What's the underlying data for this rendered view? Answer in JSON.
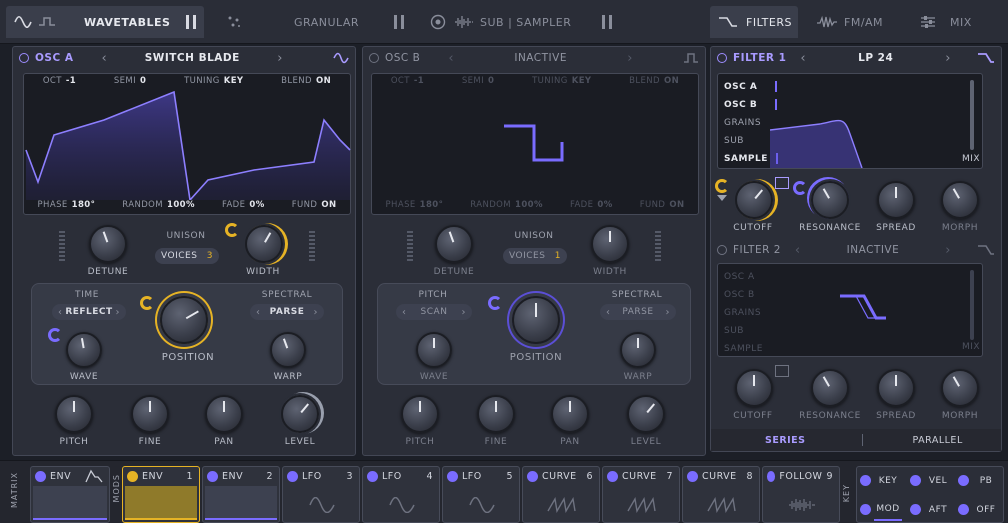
{
  "topbar": {
    "tabs": [
      {
        "label": "WAVETABLES",
        "active": true
      },
      {
        "label": "GRANULAR",
        "active": false
      },
      {
        "label": "SUB | SAMPLER",
        "active": false
      },
      {
        "label": "FILTERS",
        "active": true
      },
      {
        "label": "FM/AM",
        "active": false
      },
      {
        "label": "MIX",
        "active": false
      }
    ]
  },
  "osc_a": {
    "title": "OSC A",
    "preset": "SWITCH BLADE",
    "params_top": {
      "oct_label": "OCT",
      "oct": "-1",
      "semi_label": "SEMI",
      "semi": "0",
      "tuning_label": "TUNING",
      "tuning": "KEY",
      "blend_label": "BLEND",
      "blend": "ON"
    },
    "params_bottom": {
      "phase_label": "PHASE",
      "phase": "180°",
      "random_label": "RANDOM",
      "random": "100%",
      "fade_label": "FADE",
      "fade": "0%",
      "fund_label": "FUND",
      "fund": "ON"
    },
    "detune": "DETUNE",
    "unison": "UNISON",
    "voices_label": "VOICES",
    "voices": "3",
    "width": "WIDTH",
    "time_label": "TIME",
    "time_value": "REFLECT",
    "spectral_label": "SPECTRAL",
    "spectral_value": "PARSE",
    "wave": "WAVE",
    "position": "POSITION",
    "warp": "WARP",
    "pitch": "PITCH",
    "fine": "FINE",
    "pan": "PAN",
    "level": "LEVEL"
  },
  "osc_b": {
    "title": "OSC B",
    "preset": "INACTIVE",
    "params_top": {
      "oct_label": "OCT",
      "oct": "-1",
      "semi_label": "SEMI",
      "semi": "0",
      "tuning_label": "TUNING",
      "tuning": "KEY",
      "blend_label": "BLEND",
      "blend": "ON"
    },
    "params_bottom": {
      "phase_label": "PHASE",
      "phase": "180°",
      "random_label": "RANDOM",
      "random": "100%",
      "fade_label": "FADE",
      "fade": "0%",
      "fund_label": "FUND",
      "fund": "ON"
    },
    "detune": "DETUNE",
    "unison": "UNISON",
    "voices_label": "VOICES",
    "voices": "1",
    "width": "WIDTH",
    "pitch_label": "PITCH",
    "pitch_value": "SCAN",
    "spectral_label": "SPECTRAL",
    "spectral_value": "PARSE",
    "wave": "WAVE",
    "position": "POSITION",
    "warp": "WARP",
    "pitch": "PITCH",
    "fine": "FINE",
    "pan": "PAN",
    "level": "LEVEL"
  },
  "filter1": {
    "title": "FILTER 1",
    "type": "LP 24",
    "routes": [
      "OSC A",
      "OSC B",
      "GRAINS",
      "SUB",
      "SAMPLE"
    ],
    "mix": "MIX",
    "cutoff": "CUTOFF",
    "resonance": "RESONANCE",
    "spread": "SPREAD",
    "morph": "MORPH"
  },
  "filter2": {
    "title": "FILTER 2",
    "type": "INACTIVE",
    "routes": [
      "OSC A",
      "OSC B",
      "GRAINS",
      "SUB",
      "SAMPLE"
    ],
    "mix": "MIX",
    "cutoff": "CUTOFF",
    "resonance": "RESONANCE",
    "spread": "SPREAD",
    "morph": "MORPH"
  },
  "routing": {
    "series": "SERIES",
    "parallel": "PARALLEL"
  },
  "bottom": {
    "matrix": "MATRIX",
    "mods": "MODS",
    "key_label": "KEY",
    "modules": [
      {
        "label": "ENV",
        "num": ""
      },
      {
        "label": "ENV",
        "num": "1"
      },
      {
        "label": "ENV",
        "num": "2"
      },
      {
        "label": "LFO",
        "num": "3"
      },
      {
        "label": "LFO",
        "num": "4"
      },
      {
        "label": "LFO",
        "num": "5"
      },
      {
        "label": "CURVE",
        "num": "6"
      },
      {
        "label": "CURVE",
        "num": "7"
      },
      {
        "label": "CURVE",
        "num": "8"
      },
      {
        "label": "FOLLOW",
        "num": "9"
      }
    ],
    "keys": [
      "KEY",
      "VEL",
      "PB",
      "MOD",
      "AFT",
      "OFF"
    ]
  },
  "colors": {
    "accent": "#7a6cff",
    "accent_text": "#a99bff",
    "yellow": "#e6b325"
  }
}
